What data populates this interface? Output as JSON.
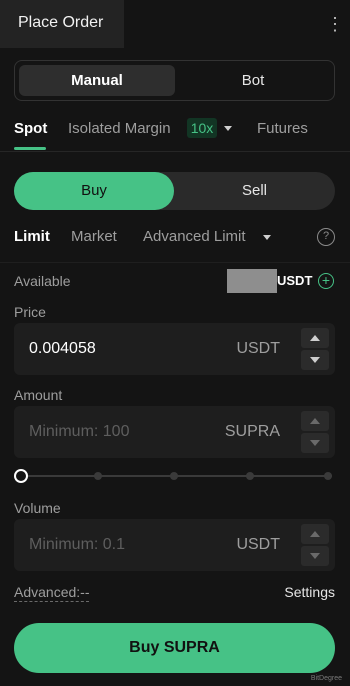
{
  "header": {
    "title": "Place Order",
    "menu_icon": "kebab-icon"
  },
  "mode": {
    "manual": "Manual",
    "bot": "Bot",
    "selected": "Manual"
  },
  "market_tabs": {
    "spot": "Spot",
    "isolated_margin": "Isolated Margin",
    "leverage": "10x",
    "futures": "Futures",
    "selected": "Spot"
  },
  "side": {
    "buy": "Buy",
    "sell": "Sell",
    "selected": "Buy"
  },
  "order_types": {
    "limit": "Limit",
    "market": "Market",
    "advanced_limit": "Advanced Limit",
    "selected": "Limit"
  },
  "available": {
    "label": "Available",
    "unit": "USDT"
  },
  "price": {
    "label": "Price",
    "value": "0.004058",
    "unit": "USDT"
  },
  "amount": {
    "label": "Amount",
    "placeholder": "Minimum: 100",
    "unit": "SUPRA"
  },
  "slider": {
    "value_percent": 0
  },
  "volume": {
    "label": "Volume",
    "placeholder": "Minimum: 0.1",
    "unit": "USDT"
  },
  "advanced": {
    "label": "Advanced:--",
    "settings": "Settings"
  },
  "submit": {
    "label": "Buy SUPRA"
  },
  "watermark": {
    "text": "BitDegree"
  },
  "colors": {
    "accent": "#46c286",
    "background": "#141414",
    "field": "#1e1e1e"
  }
}
